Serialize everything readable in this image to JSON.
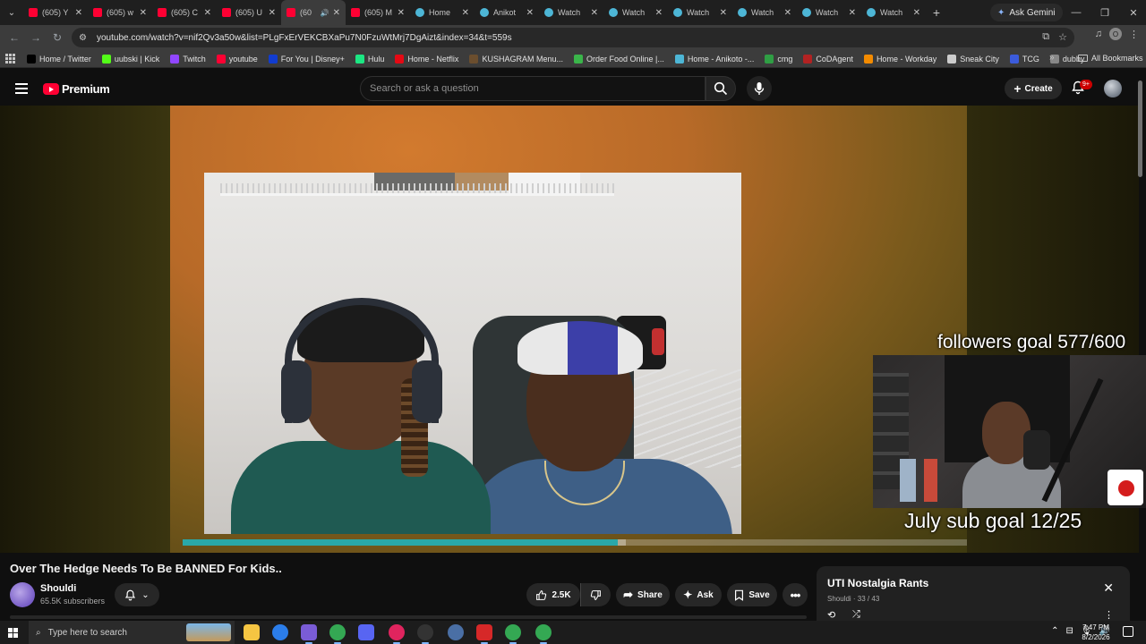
{
  "browser": {
    "tabs": [
      {
        "title": "(605) Y",
        "icon": "youtube",
        "active": false
      },
      {
        "title": "(605) w",
        "icon": "youtube",
        "active": false
      },
      {
        "title": "(605) C",
        "icon": "youtube",
        "active": false
      },
      {
        "title": "(605) U",
        "icon": "youtube",
        "active": false
      },
      {
        "title": "(60",
        "icon": "youtube",
        "active": true,
        "audio": true
      },
      {
        "title": "(605) M",
        "icon": "youtube",
        "active": false
      },
      {
        "title": "Home",
        "icon": "globe",
        "active": false
      },
      {
        "title": "Anikot",
        "icon": "globe",
        "active": false
      },
      {
        "title": "Watch",
        "icon": "globe",
        "active": false
      },
      {
        "title": "Watch",
        "icon": "globe",
        "active": false
      },
      {
        "title": "Watch",
        "icon": "globe",
        "active": false
      },
      {
        "title": "Watch",
        "icon": "globe",
        "active": false
      },
      {
        "title": "Watch",
        "icon": "globe",
        "active": false
      },
      {
        "title": "Watch",
        "icon": "globe",
        "active": false
      }
    ],
    "ask_gemini": "Ask Gemini",
    "url": "youtube.com/watch?v=nif2Qv3a50w&list=PLgFxErVEKCBXaPu7N0FzuWtMrj7DgAizt&index=34&t=559s",
    "profile_initial": "O",
    "bookmarks": [
      {
        "label": "Home / Twitter",
        "color": "#000000"
      },
      {
        "label": "uubski | Kick",
        "color": "#53fc18"
      },
      {
        "label": "Twitch",
        "color": "#9146ff"
      },
      {
        "label": "youtube",
        "color": "#ff0033"
      },
      {
        "label": "For You | Disney+",
        "color": "#113ccf"
      },
      {
        "label": "Hulu",
        "color": "#1ce783"
      },
      {
        "label": "Home - Netflix",
        "color": "#e50914"
      },
      {
        "label": "KUSHAGRAM Menu...",
        "color": "#6b4e2e"
      },
      {
        "label": "Order Food Online |...",
        "color": "#3ab54a"
      },
      {
        "label": "Home - Anikoto -...",
        "color": "#4db6d6"
      },
      {
        "label": "cmg",
        "color": "#2f9e44"
      },
      {
        "label": "CoDAgent",
        "color": "#b22222"
      },
      {
        "label": "Home - Workday",
        "color": "#f38b00"
      },
      {
        "label": "Sneak City",
        "color": "#cccccc"
      },
      {
        "label": "TCG",
        "color": "#3b5bdb"
      },
      {
        "label": "dubby",
        "color": "#888888"
      }
    ],
    "all_bookmarks": "All Bookmarks"
  },
  "youtube": {
    "logo_text": "Premium",
    "search_placeholder": "Search or ask a question",
    "create_label": "Create",
    "notifications_badge": "9+",
    "video": {
      "progress_fraction": 0.555,
      "buffer_fraction": 0.565
    },
    "overlay": {
      "followers_goal": "followers goal 577/600",
      "sub_goal": "July sub goal 12/25"
    },
    "title": "Over The Hedge Needs To Be BANNED For Kids..",
    "channel": {
      "name": "Shouldi",
      "subscribers": "65.5K subscribers"
    },
    "actions": {
      "likes": "2.5K",
      "share": "Share",
      "ask": "Ask",
      "save": "Save"
    },
    "playlist": {
      "title": "UTI Nostalgia Rants",
      "owner": "Shouldi",
      "position": "33 / 43"
    }
  },
  "taskbar": {
    "search_placeholder": "Type here to search",
    "time": "7:47 PM",
    "date": "8/2/2026"
  }
}
